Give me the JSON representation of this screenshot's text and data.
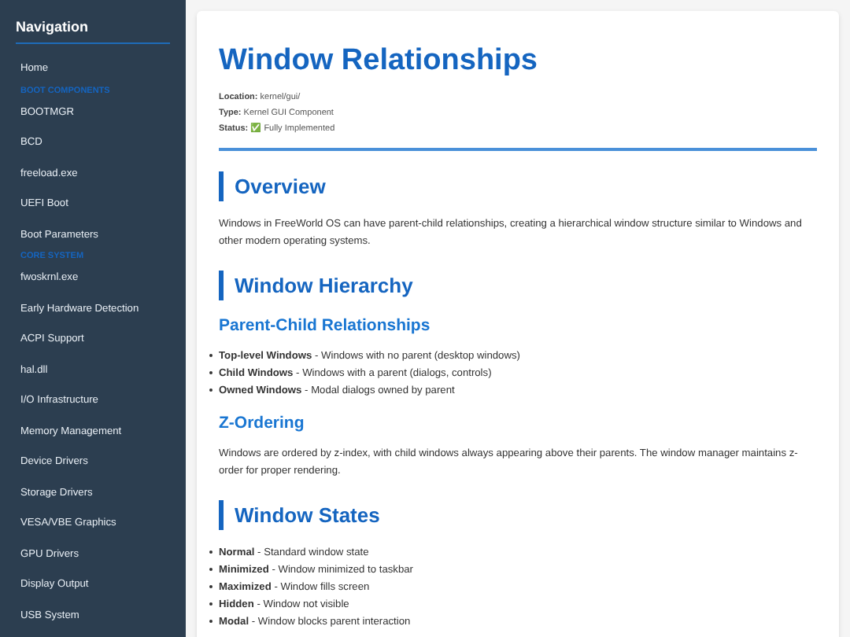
{
  "sidebar": {
    "title": "Navigation",
    "items": [
      {
        "kind": "link",
        "label": "Home"
      },
      {
        "kind": "section",
        "label": "BOOT COMPONENTS"
      },
      {
        "kind": "link",
        "label": "BOOTMGR"
      },
      {
        "kind": "link",
        "label": "BCD"
      },
      {
        "kind": "link",
        "label": "freeload.exe"
      },
      {
        "kind": "link",
        "label": "UEFI Boot"
      },
      {
        "kind": "link",
        "label": "Boot Parameters"
      },
      {
        "kind": "section",
        "label": "CORE SYSTEM"
      },
      {
        "kind": "link",
        "label": "fwoskrnl.exe"
      },
      {
        "kind": "link",
        "label": "Early Hardware Detection"
      },
      {
        "kind": "link",
        "label": "ACPI Support"
      },
      {
        "kind": "link",
        "label": "hal.dll"
      },
      {
        "kind": "link",
        "label": "I/O Infrastructure"
      },
      {
        "kind": "link",
        "label": "Memory Management"
      },
      {
        "kind": "link",
        "label": "Device Drivers"
      },
      {
        "kind": "link",
        "label": "Storage Drivers"
      },
      {
        "kind": "link",
        "label": "VESA/VBE Graphics"
      },
      {
        "kind": "link",
        "label": "GPU Drivers"
      },
      {
        "kind": "link",
        "label": "Display Output"
      },
      {
        "kind": "link",
        "label": "USB System"
      }
    ]
  },
  "page": {
    "title": "Window Relationships",
    "meta": [
      {
        "label": "Location:",
        "value": "kernel/gui/"
      },
      {
        "label": "Type:",
        "value": "Kernel GUI Component"
      },
      {
        "label": "Status:",
        "value": "✅ Fully Implemented"
      }
    ],
    "blocks": [
      {
        "kind": "h2",
        "text": "Overview"
      },
      {
        "kind": "p",
        "text": "Windows in FreeWorld OS can have parent-child relationships, creating a hierarchical window structure similar to Windows and other modern operating systems."
      },
      {
        "kind": "h2",
        "text": "Window Hierarchy"
      },
      {
        "kind": "h3",
        "text": "Parent-Child Relationships"
      },
      {
        "kind": "ul",
        "items": [
          "**Top-level Windows** - Windows with no parent (desktop windows)",
          "**Child Windows** - Windows with a parent (dialogs, controls)",
          "**Owned Windows** - Modal dialogs owned by parent"
        ]
      },
      {
        "kind": "h3",
        "text": "Z-Ordering"
      },
      {
        "kind": "p",
        "text": "Windows are ordered by z-index, with child windows always appearing above their parents. The window manager maintains z-order for proper rendering."
      },
      {
        "kind": "h2",
        "text": "Window States"
      },
      {
        "kind": "ul",
        "items": [
          "**Normal** - Standard window state",
          "**Minimized** - Window minimized to taskbar",
          "**Maximized** - Window fills screen",
          "**Hidden** - Window not visible",
          "**Modal** - Window blocks parent interaction"
        ]
      }
    ]
  }
}
